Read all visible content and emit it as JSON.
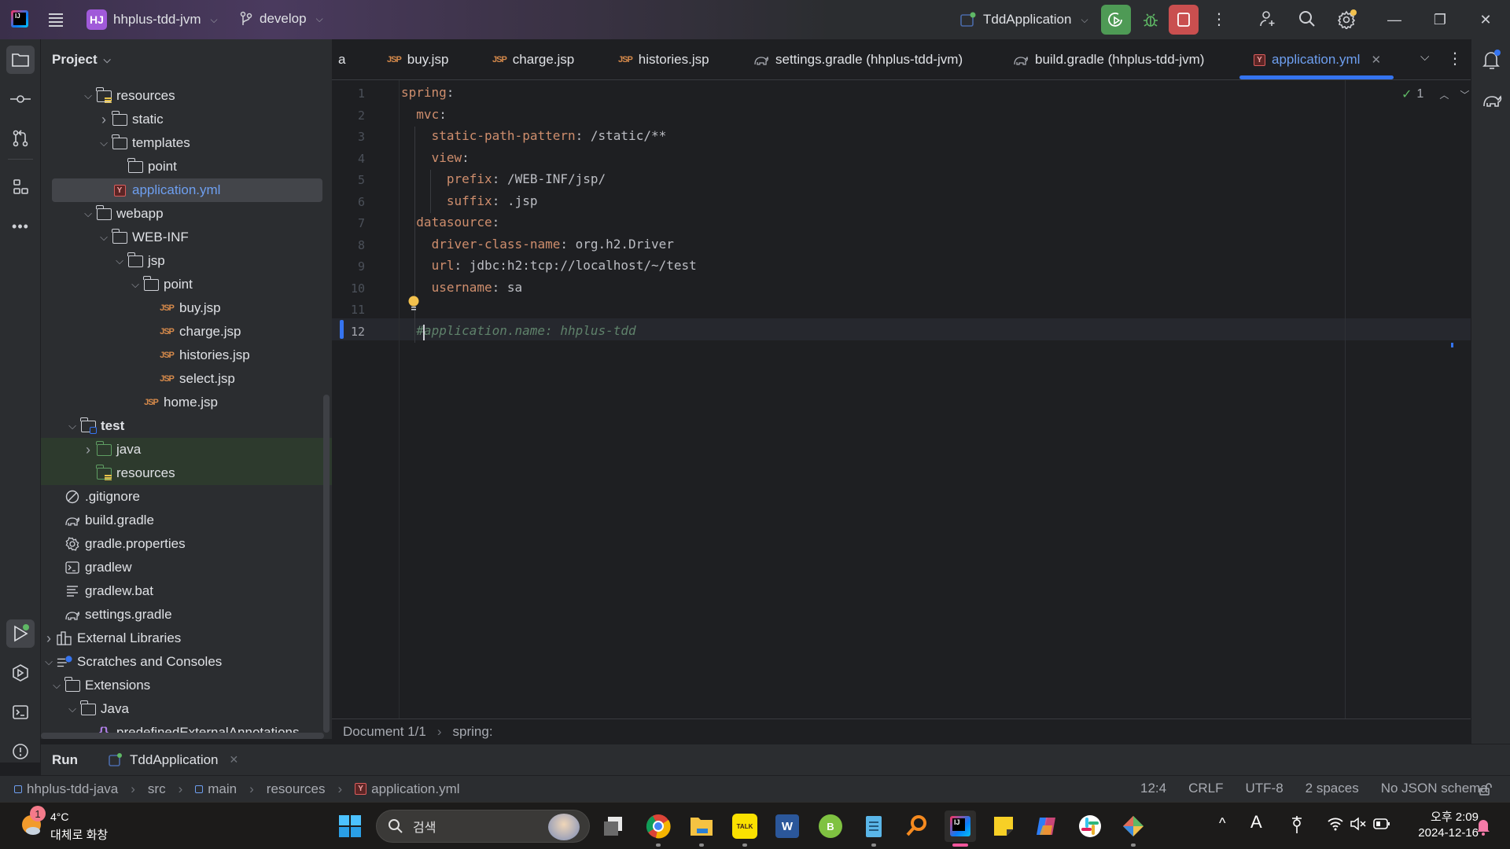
{
  "titlebar": {
    "project_initials": "HJ",
    "project_name": "hhplus-tdd-jvm",
    "branch": "develop",
    "run_config": "TddApplication",
    "window_controls": [
      "minimize",
      "restore",
      "close"
    ]
  },
  "project_panel": {
    "title": "Project",
    "tree": [
      {
        "label": "resources",
        "type": "resources-folder",
        "expanded": true
      },
      {
        "label": "static",
        "type": "folder",
        "expanded": false
      },
      {
        "label": "templates",
        "type": "folder",
        "expanded": true
      },
      {
        "label": "point",
        "type": "folder"
      },
      {
        "label": "application.yml",
        "type": "yml",
        "selected": true
      },
      {
        "label": "webapp",
        "type": "folder",
        "expanded": true
      },
      {
        "label": "WEB-INF",
        "type": "folder",
        "expanded": true
      },
      {
        "label": "jsp",
        "type": "folder",
        "expanded": true
      },
      {
        "label": "point",
        "type": "folder",
        "expanded": true
      },
      {
        "label": "buy.jsp",
        "type": "jsp"
      },
      {
        "label": "charge.jsp",
        "type": "jsp"
      },
      {
        "label": "histories.jsp",
        "type": "jsp"
      },
      {
        "label": "select.jsp",
        "type": "jsp"
      },
      {
        "label": "home.jsp",
        "type": "jsp"
      },
      {
        "label": "test",
        "type": "test-folder",
        "expanded": true
      },
      {
        "label": "java",
        "type": "green-folder",
        "expanded": false
      },
      {
        "label": "resources",
        "type": "test-resources-folder"
      },
      {
        "label": ".gitignore",
        "type": "gitignore"
      },
      {
        "label": "build.gradle",
        "type": "gradle"
      },
      {
        "label": "gradle.properties",
        "type": "properties"
      },
      {
        "label": "gradlew",
        "type": "terminal"
      },
      {
        "label": "gradlew.bat",
        "type": "text"
      },
      {
        "label": "settings.gradle",
        "type": "gradle"
      },
      {
        "label": "External Libraries",
        "type": "libraries",
        "expanded": false
      },
      {
        "label": "Scratches and Consoles",
        "type": "scratches",
        "expanded": true
      },
      {
        "label": "Extensions",
        "type": "folder",
        "expanded": true
      },
      {
        "label": "Java",
        "type": "folder",
        "expanded": true
      },
      {
        "label": "predefinedExternalAnnotations",
        "type": "json"
      }
    ]
  },
  "tabs": [
    {
      "label": "a",
      "icon": "partial"
    },
    {
      "label": "buy.jsp",
      "icon": "jsp"
    },
    {
      "label": "charge.jsp",
      "icon": "jsp"
    },
    {
      "label": "histories.jsp",
      "icon": "jsp"
    },
    {
      "label": "settings.gradle (hhplus-tdd-jvm)",
      "icon": "gradle"
    },
    {
      "label": "build.gradle (hhplus-tdd-jvm)",
      "icon": "gradle"
    },
    {
      "label": "application.yml",
      "icon": "yml",
      "active": true
    }
  ],
  "editor": {
    "inspection_count": "1",
    "lines": [
      {
        "n": "1",
        "key": "spring",
        "sep": ":",
        "val": ""
      },
      {
        "n": "2",
        "key": "mvc",
        "sep": ":",
        "val": ""
      },
      {
        "n": "3",
        "key": "static-path-pattern",
        "sep": ": ",
        "val": "/static/**"
      },
      {
        "n": "4",
        "key": "view",
        "sep": ":",
        "val": ""
      },
      {
        "n": "5",
        "key": "prefix",
        "sep": ": ",
        "val": "/WEB-INF/jsp/"
      },
      {
        "n": "6",
        "key": "suffix",
        "sep": ": ",
        "val": ".jsp"
      },
      {
        "n": "7",
        "key": "datasource",
        "sep": ":",
        "val": ""
      },
      {
        "n": "8",
        "key": "driver-class-name",
        "sep": ": ",
        "val": "org.h2.Driver"
      },
      {
        "n": "9",
        "key": "url",
        "sep": ": ",
        "val": "jdbc:h2:tcp://localhost/~/test"
      },
      {
        "n": "10",
        "key": "username",
        "sep": ": ",
        "val": "sa"
      },
      {
        "n": "11",
        "key": "",
        "sep": "",
        "val": ""
      },
      {
        "n": "12",
        "comment": "#application.name: hhplus-tdd"
      }
    ],
    "breadcrumb": [
      "Document 1/1",
      "spring:"
    ]
  },
  "run_bar": {
    "label": "Run",
    "config_tab": "TddApplication"
  },
  "status_bar": {
    "path": [
      "hhplus-tdd-java",
      "src",
      "main",
      "resources",
      "application.yml"
    ],
    "cursor": "12:4",
    "line_ending": "CRLF",
    "encoding": "UTF-8",
    "indent": "2 spaces",
    "schema": "No JSON schema"
  },
  "taskbar": {
    "weather_temp": "4°C",
    "weather_desc": "대체로 화창",
    "weather_badge": "1",
    "search_placeholder": "검색",
    "clock_time": "오후 2:09",
    "clock_date": "2024-12-16",
    "ime": "A"
  }
}
